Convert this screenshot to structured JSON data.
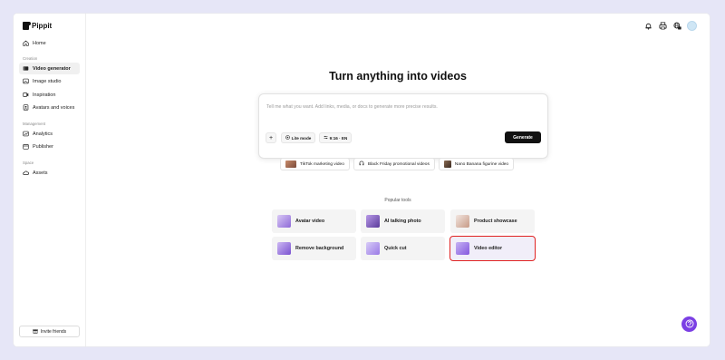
{
  "app": {
    "name": "Pippit"
  },
  "sidebar": {
    "home": "Home",
    "creation_label": "Creation",
    "creation_items": [
      "Video generator",
      "Image studio",
      "Inspiration",
      "Avatars and voices"
    ],
    "management_label": "Management",
    "management_items": [
      "Analytics",
      "Publisher"
    ],
    "space_label": "Space",
    "space_items": [
      "Assets"
    ],
    "invite_label": "Invite friends"
  },
  "header": {
    "icons": [
      "bell-icon",
      "printer-icon",
      "language-icon",
      "avatar"
    ]
  },
  "main": {
    "headline": "Turn anything into videos",
    "prompt_placeholder": "Tell me what you want. Add links, media, or docs to generate more precise results.",
    "plus_label": "+",
    "lite_mode_label": "Lite mode",
    "ratio_label": "9:16 · EN",
    "generate_label": "Generate",
    "suggestions": [
      "TikTok marketing video",
      "Black Friday promotional videos",
      "Nano Banana figurine video"
    ],
    "popular_label": "Popular tools",
    "tools": [
      "Avatar video",
      "AI talking photo",
      "Product showcase",
      "Remove background",
      "Quick cut",
      "Video editor"
    ]
  },
  "colors": {
    "accent": "#7b3fe4",
    "background": "#e6e6f7",
    "selected_outline": "#e02424"
  }
}
